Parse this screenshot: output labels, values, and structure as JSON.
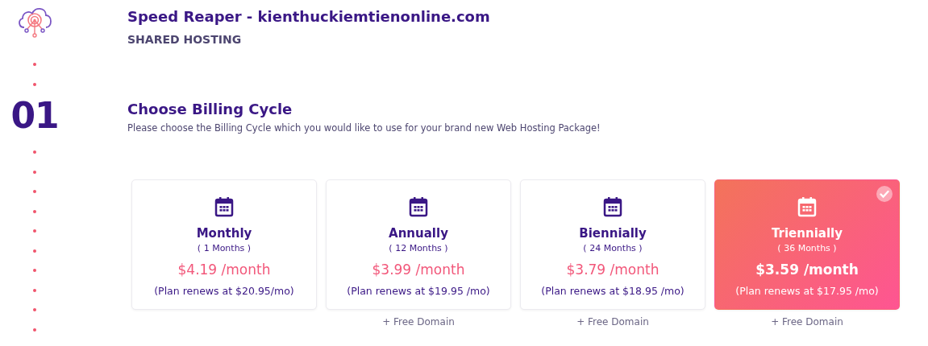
{
  "header": {
    "title": "Speed Reaper - kienthuckiemtienonline.com",
    "subtitle": "SHARED HOSTING"
  },
  "step": {
    "number": "01",
    "title": "Choose Billing Cycle",
    "description": "Please choose the Billing Cycle which you would like to use for your brand new Web Hosting Package!"
  },
  "plans": [
    {
      "name": "Monthly",
      "months": "( 1 Months )",
      "price": "$4.19 /month",
      "renews": "(Plan renews at $20.95/mo)",
      "selected": false
    },
    {
      "name": "Annually",
      "months": "( 12 Months )",
      "price": "$3.99 /month",
      "renews": "(Plan renews at $19.95 /mo)",
      "selected": false,
      "extra": "+ Free Domain"
    },
    {
      "name": "Biennially",
      "months": "( 24 Months )",
      "price": "$3.79 /month",
      "renews": "(Plan renews at $18.95 /mo)",
      "selected": false,
      "extra": "+ Free Domain"
    },
    {
      "name": "Triennially",
      "months": "( 36 Months )",
      "price": "$3.59 /month",
      "renews": "(Plan renews at $17.95 /mo)",
      "selected": true,
      "extra": "+ Free Domain"
    }
  ]
}
